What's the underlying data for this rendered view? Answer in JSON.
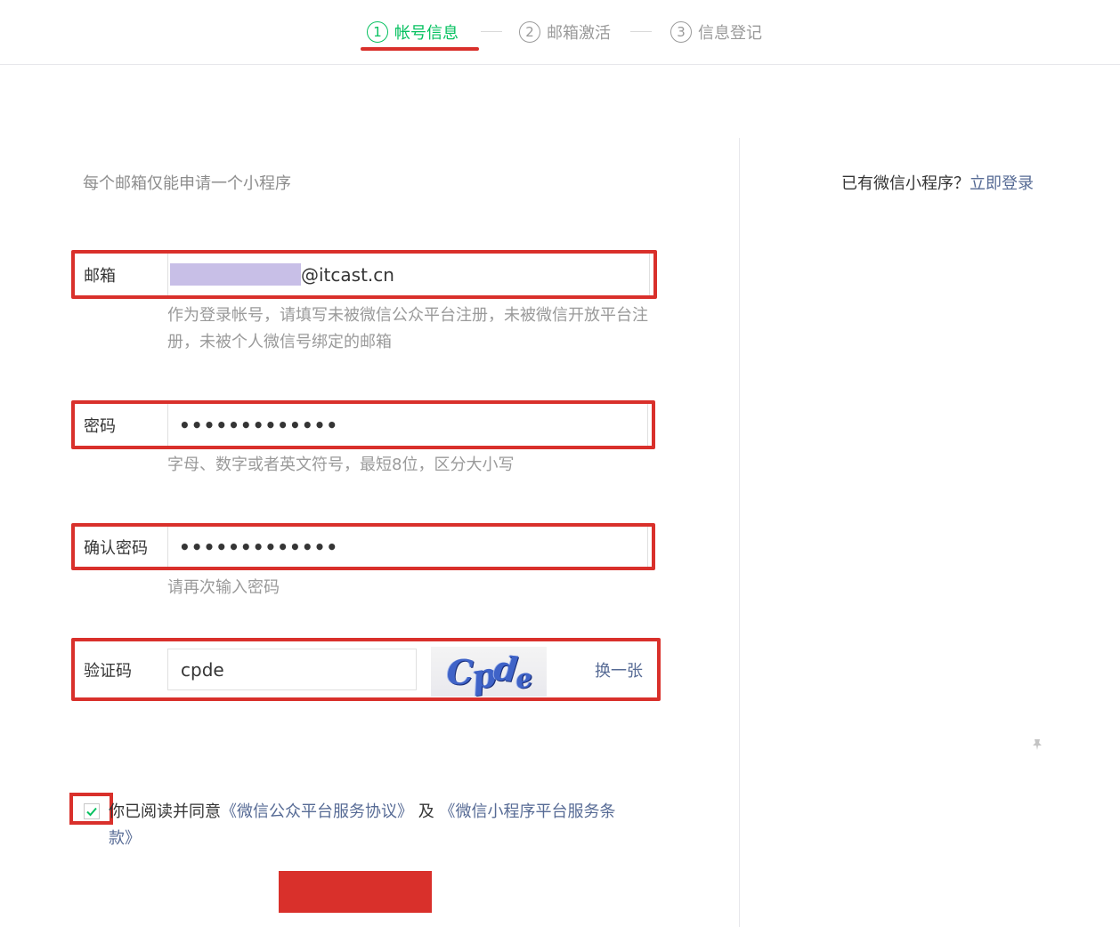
{
  "steps": [
    {
      "num": "1",
      "label": "帐号信息"
    },
    {
      "num": "2",
      "label": "邮箱激活"
    },
    {
      "num": "3",
      "label": "信息登记"
    }
  ],
  "tip_top": "每个邮箱仅能申请一个小程序",
  "login": {
    "question": "已有微信小程序？",
    "link": "立即登录"
  },
  "email": {
    "label": "邮箱",
    "value_suffix": "@itcast.cn",
    "hint": "作为登录帐号，请填写未被微信公众平台注册，未被微信开放平台注册，未被个人微信号绑定的邮箱"
  },
  "password": {
    "label": "密码",
    "value": "•••••••••••••",
    "hint": "字母、数字或者英文符号，最短8位，区分大小写"
  },
  "confirm_password": {
    "label": "确认密码",
    "value": "•••••••••••••",
    "hint": "请再次输入密码"
  },
  "captcha": {
    "label": "验证码",
    "value": "cpde",
    "image_text": [
      "C",
      "p",
      "d",
      "e"
    ],
    "refresh": "换一张"
  },
  "agreement": {
    "checked": true,
    "prefix": "你已阅读并同意",
    "link1": "《微信公众平台服务协议》",
    "middle": "及",
    "link2": "《微信小程序平台服务条款》"
  },
  "colors": {
    "accent_green": "#07c160",
    "highlight_red": "#d9302b",
    "link_blue": "#576b95",
    "redaction": "#c8bfe7"
  }
}
